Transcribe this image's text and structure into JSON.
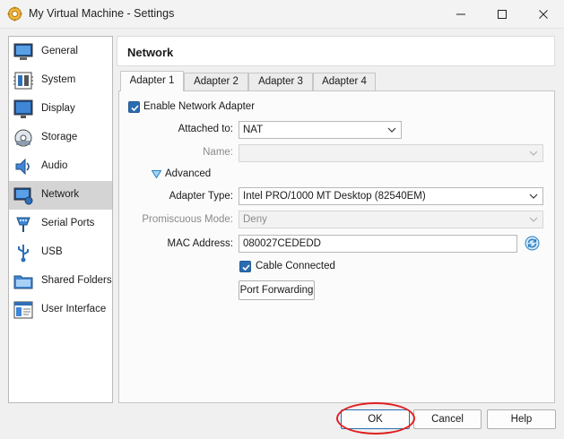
{
  "window": {
    "title": "My Virtual Machine - Settings",
    "icon": "virtualbox-gear-icon",
    "controls": [
      "minimize-icon",
      "maximize-icon",
      "close-icon"
    ]
  },
  "sidebar": {
    "items": [
      {
        "label": "General",
        "icon": "general-monitor-icon"
      },
      {
        "label": "System",
        "icon": "system-chip-icon"
      },
      {
        "label": "Display",
        "icon": "display-monitor-icon"
      },
      {
        "label": "Storage",
        "icon": "storage-disk-icon"
      },
      {
        "label": "Audio",
        "icon": "audio-speaker-icon"
      },
      {
        "label": "Network",
        "icon": "network-icon",
        "selected": true
      },
      {
        "label": "Serial Ports",
        "icon": "serial-port-icon"
      },
      {
        "label": "USB",
        "icon": "usb-icon"
      },
      {
        "label": "Shared Folders",
        "icon": "shared-folder-icon"
      },
      {
        "label": "User Interface",
        "icon": "user-interface-icon"
      }
    ]
  },
  "page": {
    "title": "Network",
    "tabs": [
      {
        "label": "Adapter 1",
        "active": true
      },
      {
        "label": "Adapter 2"
      },
      {
        "label": "Adapter 3"
      },
      {
        "label": "Adapter 4"
      }
    ],
    "enable_adapter": {
      "label": "Enable Network Adapter",
      "checked": true
    },
    "attached_to": {
      "label": "Attached to:",
      "value": "NAT"
    },
    "name": {
      "label": "Name:",
      "value": "",
      "disabled": true
    },
    "advanced": {
      "label": "Advanced",
      "expanded": true
    },
    "adapter_type": {
      "label": "Adapter Type:",
      "value": "Intel PRO/1000 MT Desktop (82540EM)"
    },
    "promiscuous_mode": {
      "label": "Promiscuous Mode:",
      "value": "Deny",
      "disabled": true
    },
    "mac_address": {
      "label": "MAC Address:",
      "value": "080027CEDEDD",
      "refresh_icon": "refresh-mac-icon"
    },
    "cable_connected": {
      "label": "Cable Connected",
      "checked": true
    },
    "port_forwarding": {
      "label": "Port Forwarding"
    }
  },
  "footer": {
    "ok": "OK",
    "cancel": "Cancel",
    "help": "Help"
  },
  "colors": {
    "accent": "#2b6cb0",
    "callout": "#e02020",
    "selected_item": "#d4d4d4"
  }
}
